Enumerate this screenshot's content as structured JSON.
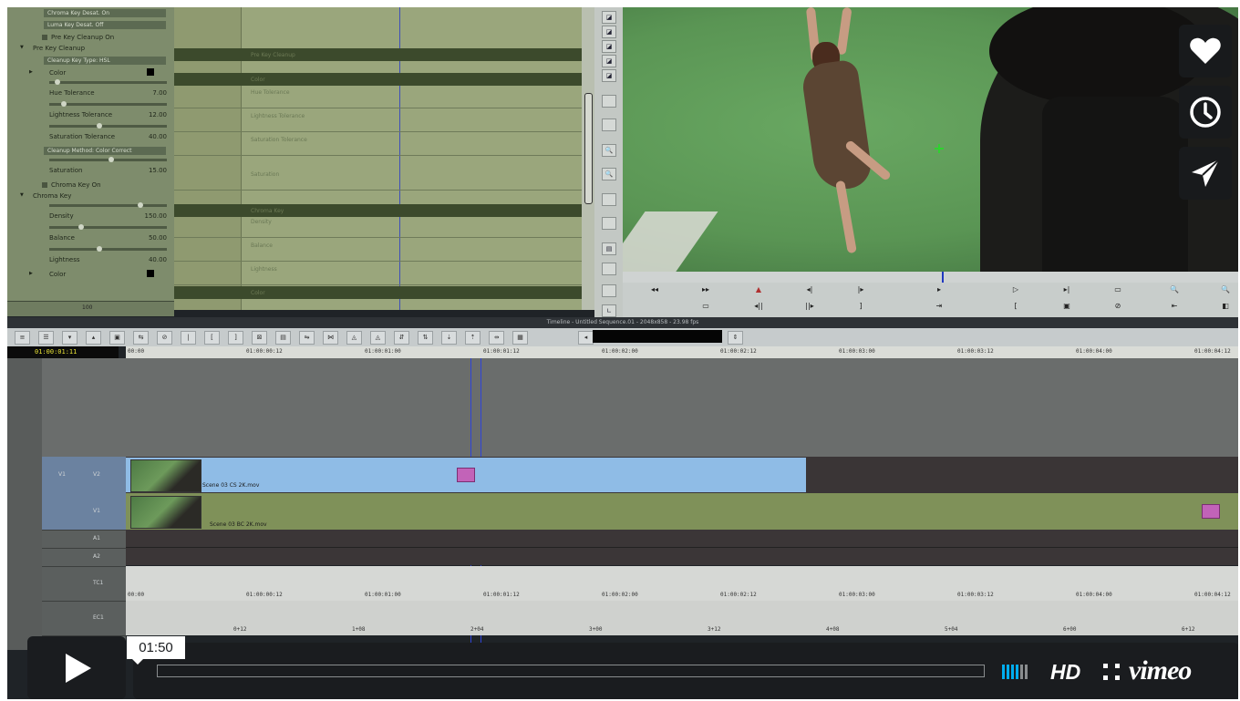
{
  "effect_editor": {
    "rows": [
      {
        "label": "Chroma Key Desat. On",
        "type": "dropdown"
      },
      {
        "label": "Luma Key Desat. Off",
        "type": "dropdown"
      },
      {
        "label": "Pre Key Cleanup On",
        "type": "checkbox"
      },
      {
        "label": "Pre Key Cleanup",
        "type": "section"
      },
      {
        "label": "Cleanup Key Type: HSL",
        "type": "dropdown"
      },
      {
        "label": "Color",
        "type": "color"
      },
      {
        "label": "Hue Tolerance",
        "value": "7.00",
        "knob": 0.05
      },
      {
        "label": "Lightness Tolerance",
        "value": "12.00",
        "knob": 0.1
      },
      {
        "label": "Saturation Tolerance",
        "value": "40.00",
        "knob": 0.4
      },
      {
        "label": "Cleanup Method: Color Correct",
        "type": "dropdown"
      },
      {
        "label": "Saturation",
        "value": "15.00",
        "knob": 0.5
      },
      {
        "label": "Chroma Key On",
        "type": "checkbox"
      },
      {
        "label": "Chroma Key",
        "type": "section"
      },
      {
        "label": "Density",
        "value": "150.00",
        "knob": 0.75
      },
      {
        "label": "Balance",
        "value": "50.00",
        "knob": 0.25
      },
      {
        "label": "Lightness",
        "value": "40.00",
        "knob": 0.4
      },
      {
        "label": "Color",
        "type": "color"
      }
    ],
    "bottom_counter": "100"
  },
  "keyframe_grid": {
    "strips": [
      "Pre Key Cleanup",
      "Color",
      "Chroma Key",
      "Color"
    ],
    "labels": [
      "Hue Tolerance",
      "Lightness Tolerance",
      "Saturation Tolerance",
      "Saturation",
      "Density",
      "Balance",
      "Lightness"
    ]
  },
  "viewer": {
    "scrub_position": 0.52
  },
  "timeline": {
    "title": "Timeline - Untitled Sequence.01 - 2048x858 - 23.98 fps",
    "timecode": "01:00:01:11",
    "ruler": [
      "00:00",
      "01:00:00:12",
      "01:00:01:00",
      "01:00:01:12",
      "01:00:02:00",
      "01:00:02:12",
      "01:00:03:00",
      "01:00:03:12",
      "01:00:04:00",
      "01:00:04:12"
    ],
    "tracks": [
      {
        "id": "V2",
        "source": "V1",
        "clip": "Scene 03 CS 2K.mov",
        "color": "#8fbce6"
      },
      {
        "id": "V1",
        "clip": "Scene 03 BC 2K.mov",
        "color": "#7f9159"
      },
      {
        "id": "A1"
      },
      {
        "id": "A2"
      },
      {
        "id": "TC1"
      },
      {
        "id": "EC1"
      }
    ],
    "tc_track": [
      "00:00",
      "01:00:00:12",
      "01:00:01:00",
      "01:00:01:12",
      "01:00:02:00",
      "01:00:02:12",
      "01:00:03:00",
      "01:00:03:12",
      "01:00:04:00",
      "01:00:04:12"
    ],
    "ec_track": [
      "0+12",
      "1+08",
      "2+04",
      "3+00",
      "3+12",
      "4+08",
      "5+04",
      "6+00",
      "6+12"
    ]
  },
  "player": {
    "time_tooltip": "01:50",
    "progress": 0.0,
    "hd_label": "HD",
    "brand": "vimeo",
    "accent": "#00adef",
    "side_buttons": [
      {
        "name": "like-button",
        "icon": "heart-icon"
      },
      {
        "name": "watch-later-button",
        "icon": "clock-icon"
      },
      {
        "name": "share-button",
        "icon": "paper-plane-icon"
      }
    ]
  }
}
